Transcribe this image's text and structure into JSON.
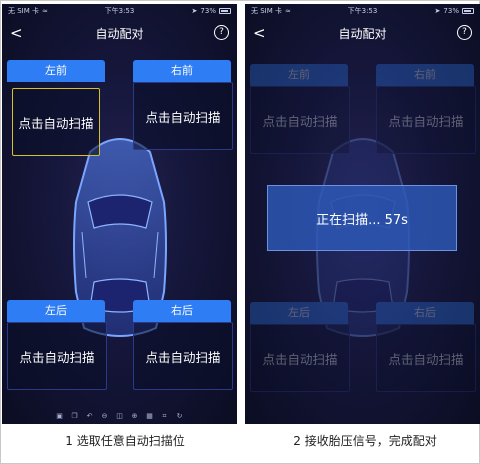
{
  "status": {
    "carrier": "无 SIM 卡",
    "time": "下午3:53",
    "battery": "73%"
  },
  "title": "自动配对",
  "help_label": "?",
  "back_label": "<",
  "tabs": {
    "fl": "左前",
    "fr": "右前",
    "rl": "左后",
    "rr": "右后"
  },
  "slot_label": "点击自动扫描",
  "scan_text": "正在扫描... 57s",
  "toolbar_icons": [
    "save-icon",
    "copy-icon",
    "undo-icon",
    "zoom-out-icon",
    "reset-icon",
    "zoom-in-icon",
    "grid-icon",
    "crop-icon",
    "rotate-icon"
  ],
  "captions": {
    "left": "1 选取任意自动扫描位",
    "right": "2 接收胎压信号，完成配对"
  },
  "colors": {
    "tab_blue": "#2f7df4",
    "selection_yellow": "#d5c12a",
    "background": "#15163a",
    "dialog_blue": "#2e5cbe"
  }
}
